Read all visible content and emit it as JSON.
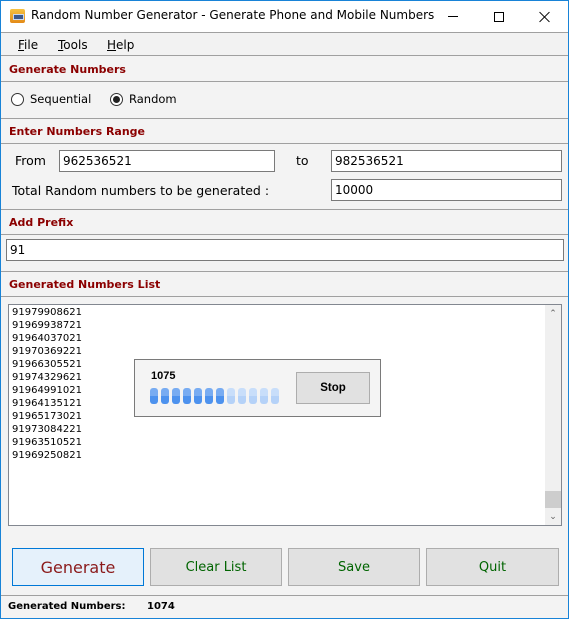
{
  "window": {
    "title": "Random Number Generator - Generate Phone and Mobile Numbers"
  },
  "menu": {
    "items": [
      {
        "label": "File",
        "accel": "F",
        "rest": "ile"
      },
      {
        "label": "Tools",
        "accel": "T",
        "rest": "ools"
      },
      {
        "label": "Help",
        "accel": "H",
        "rest": "elp"
      }
    ]
  },
  "generate": {
    "header": "Generate Numbers",
    "options": [
      {
        "label": "Sequential",
        "checked": false
      },
      {
        "label": "Random",
        "checked": true
      }
    ]
  },
  "range": {
    "header": "Enter Numbers Range",
    "from_label": "From",
    "from_value": "962536521",
    "to_label": "to",
    "to_value": "982536521",
    "total_label": "Total Random numbers to be generated :",
    "total_value": "10000"
  },
  "prefix": {
    "header": "Add Prefix",
    "value": "91"
  },
  "list": {
    "header": "Generated Numbers List",
    "items": [
      "91979908621",
      "91969938721",
      "91964037021",
      "91970369221",
      "91966305521",
      "91974329621",
      "91964991021",
      "91964135121",
      "91965173021",
      "91973084221",
      "91963510521",
      "91969250821"
    ]
  },
  "progress_popup": {
    "count": "1075",
    "segments_total": 12,
    "segments_filled": 7,
    "stop_label": "Stop",
    "colors": {
      "filled": "#5b9bf0",
      "empty": "#c0d9f9"
    }
  },
  "buttons": {
    "generate": "Generate",
    "clear": "Clear List",
    "save": "Save",
    "quit": "Quit"
  },
  "status": {
    "label": "Generated Numbers:",
    "value": "1074"
  },
  "colors": {
    "section_header": "#8b0000",
    "button_text": "#006400",
    "generate_text": "#8b1a1a",
    "window_border": "#1883d7"
  }
}
